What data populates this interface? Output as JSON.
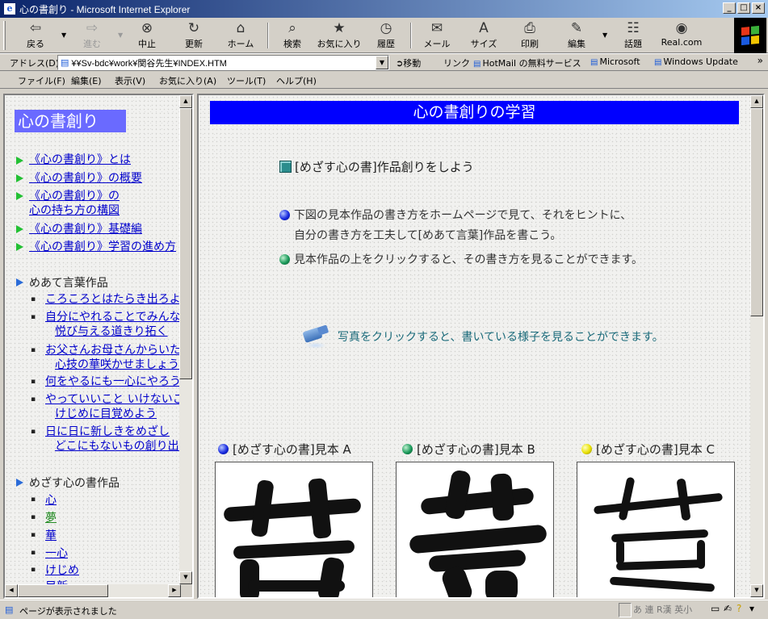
{
  "window": {
    "title": "心の書創り - Microsoft Internet Explorer",
    "buttons": {
      "minimize": "_",
      "maximize": "□",
      "close": "×"
    }
  },
  "toolbar": {
    "buttons": [
      {
        "label": "戻る",
        "icon": "⇦",
        "icon_name": "back-arrow-icon"
      },
      {
        "label": "進む",
        "icon": "⇨",
        "icon_name": "forward-arrow-icon"
      },
      {
        "label": "中止",
        "icon": "⊗",
        "icon_name": "stop-icon"
      },
      {
        "label": "更新",
        "icon": "↻",
        "icon_name": "refresh-icon"
      },
      {
        "label": "ホーム",
        "icon": "⌂",
        "icon_name": "home-icon"
      },
      {
        "label": "検索",
        "icon": "⌕",
        "icon_name": "search-icon"
      },
      {
        "label": "お気に入り",
        "icon": "★",
        "icon_name": "favorites-icon"
      },
      {
        "label": "履歴",
        "icon": "◷",
        "icon_name": "history-icon"
      },
      {
        "label": "メール",
        "icon": "✉",
        "icon_name": "mail-icon"
      },
      {
        "label": "サイズ",
        "icon": "A",
        "icon_name": "text-size-icon"
      },
      {
        "label": "印刷",
        "icon": "⎙",
        "icon_name": "print-icon"
      },
      {
        "label": "編集",
        "icon": "✎",
        "icon_name": "edit-icon"
      },
      {
        "label": "話題",
        "icon": "☷",
        "icon_name": "discuss-icon"
      },
      {
        "label": "Real.com",
        "icon": "◉",
        "icon_name": "realcom-icon"
      }
    ]
  },
  "address_bar": {
    "label": "アドレス(D)",
    "url": "¥¥Sv-bdc¥work¥関谷先生¥INDEX.HTM",
    "go_label": "移動",
    "links_label": "リンク",
    "links": [
      "HotMail の無料サービス",
      "Microsoft",
      "Windows Update"
    ]
  },
  "menu": [
    "ファイル(F)",
    "編集(E)",
    "表示(V)",
    "お気に入り(A)",
    "ツール(T)",
    "ヘルプ(H)"
  ],
  "left_nav": {
    "site_title": "心の書創り",
    "main_links": [
      "《心の書創り》とは",
      "《心の書創り》の概要",
      "《心の書創り》の",
      "心の持ち方の構図",
      "《心の書創り》基礎編",
      "《心の書創り》学習の進め方"
    ],
    "section1": {
      "title": "めあて言葉作品",
      "items": [
        "ころころとはたらき出ろよ",
        "自分にやれることでみんな",
        "悦び与える道きり拓く",
        "お父さんお母さんからいた",
        "心技の華咲かせましょう",
        "何をやるにも一心にやろう",
        "やっていいこと いけないこ",
        "けじめに目覚めよう",
        "日に日に新しきをめざし",
        "どこにもないもの創り出そ"
      ]
    },
    "section2": {
      "title": "めざす心の書作品",
      "items": [
        "心",
        "夢",
        "華",
        "一心",
        "けじめ",
        "目新"
      ]
    }
  },
  "main": {
    "header": "心の書創りの学習",
    "heading": "[めざす心の書]作品創りをしよう",
    "para1_line1": "下図の見本作品の書き方をホームページで見て、それをヒントに、",
    "para1_line2": "自分の書き方を工夫して[めあて言葉]作品を書こう。",
    "para2": "見本作品の上をクリックすると、その書き方を見ることができます。",
    "camera_text": "写真をクリックすると、書いている様子を見ることができます。",
    "samples": [
      {
        "label": "[めざす心の書]見本 A",
        "ball": "blue"
      },
      {
        "label": "[めざす心の書]見本 B",
        "ball": "green"
      },
      {
        "label": "[めざす心の書]見本 C",
        "ball": "yellow"
      }
    ]
  },
  "status": {
    "text": "ページが表示されました",
    "ime": "あ 連 R漢 英小"
  },
  "colors": {
    "header_blue": "#0000ff",
    "site_title_bg": "#6a6aff",
    "link": "#0000cc",
    "visited_link": "#228b22",
    "camera_text": "#1a6a7a"
  }
}
